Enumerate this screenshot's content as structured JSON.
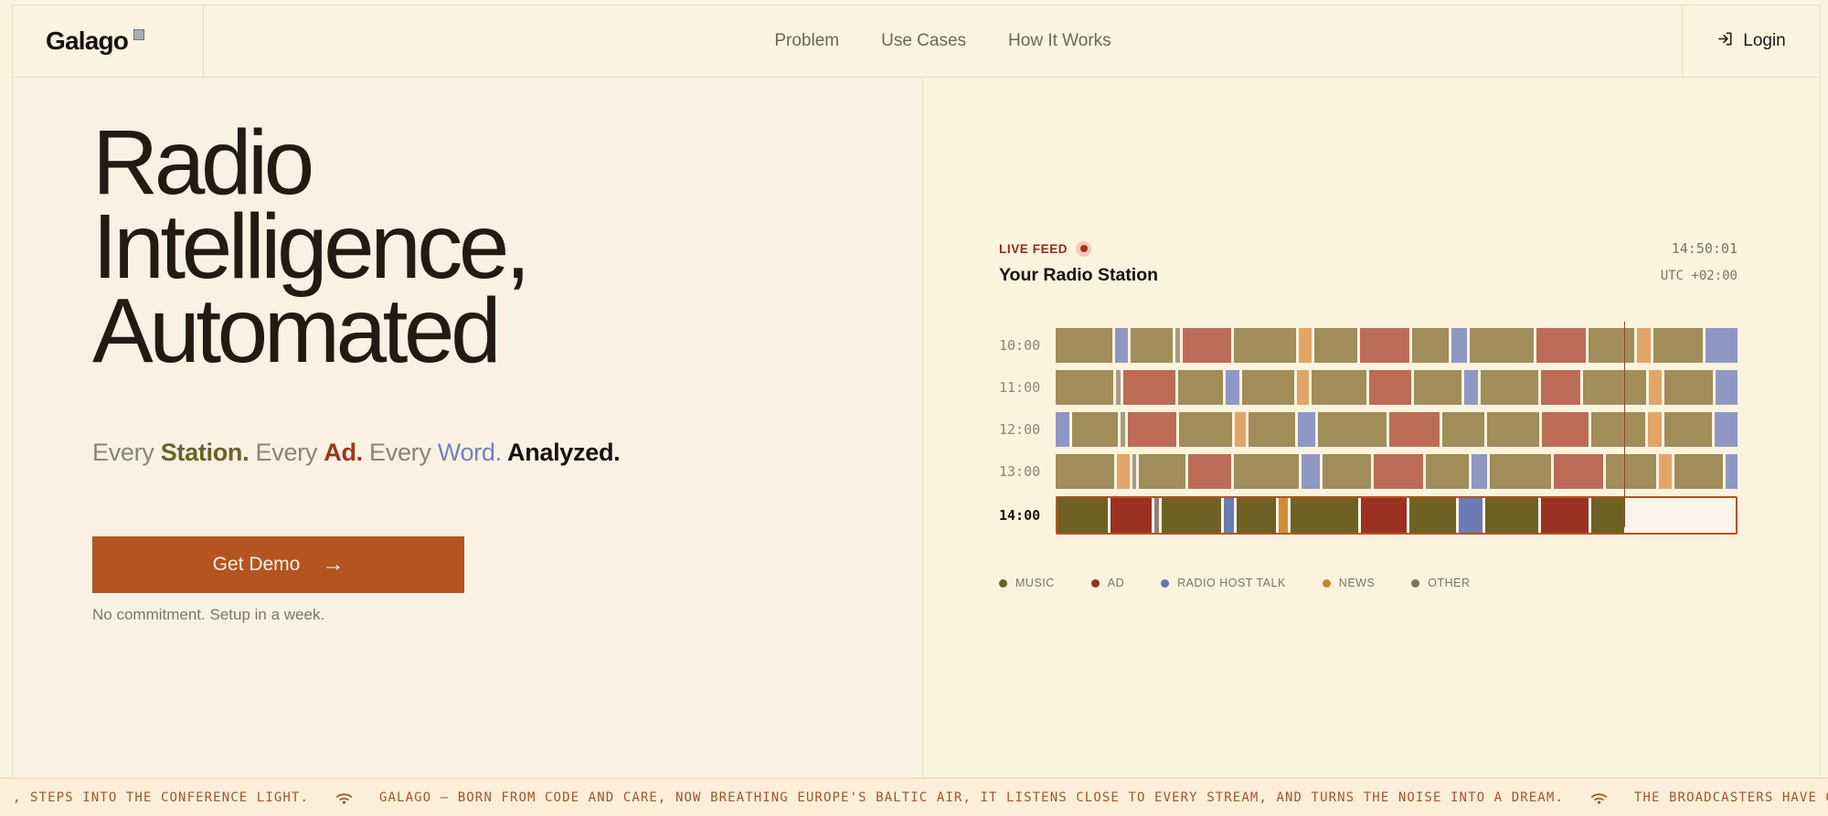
{
  "brand": {
    "name": "Galago"
  },
  "nav": {
    "items": [
      {
        "label": "Problem"
      },
      {
        "label": "Use Cases"
      },
      {
        "label": "How It Works"
      }
    ],
    "login_label": "Login"
  },
  "hero": {
    "title_lines": [
      "Radio",
      "Intelligence,",
      "Automated"
    ],
    "tagline": [
      {
        "text": "Every ",
        "style": "muted"
      },
      {
        "text": "Station.",
        "style": "station"
      },
      {
        "text": " Every ",
        "style": "muted"
      },
      {
        "text": "Ad.",
        "style": "ad"
      },
      {
        "text": " Every ",
        "style": "muted"
      },
      {
        "text": "Word.",
        "style": "word"
      },
      {
        "text": " Analyzed.",
        "style": "analyzed"
      }
    ],
    "cta_label": "Get Demo",
    "cta_arrow": "→",
    "cta_note": "No commitment. Setup in a week."
  },
  "live_feed": {
    "label": "LIVE FEED",
    "clock": "14:50:01",
    "station_title": "Your Radio Station",
    "timezone": "UTC +02:00"
  },
  "chart_data": {
    "type": "timeline",
    "title": "Your Radio Station",
    "x_unit": "minutes of each hour (0-60)",
    "now_time": "14:50:01",
    "now_fraction": 0.8335,
    "categories": [
      "MUSIC",
      "AD",
      "RADIO HOST TALK",
      "NEWS",
      "OTHER"
    ],
    "palette": {
      "muted": {
        "music": "#A18D59",
        "ad": "#BC6C56",
        "host": "#8F98C3",
        "news": "#E2A568",
        "other": "#A99B84",
        "empty": "transparent"
      },
      "active": {
        "music": "#6E6124",
        "ad": "#9A3122",
        "host": "#6B7CB4",
        "news": "#CE8C35",
        "other": "#8D8272",
        "empty": "transparent"
      }
    },
    "legend": [
      {
        "label": "MUSIC",
        "color": "#6E6124"
      },
      {
        "label": "AD",
        "color": "#99301F"
      },
      {
        "label": "RADIO HOST TALK",
        "color": "#5F74B2"
      },
      {
        "label": "NEWS",
        "color": "#CC8329"
      },
      {
        "label": "OTHER",
        "color": "#7D7260"
      }
    ],
    "rows": [
      {
        "label": "10:00",
        "active": false,
        "segments": [
          [
            "music",
            105
          ],
          [
            "host",
            25
          ],
          [
            "music",
            78
          ],
          [
            "other",
            8
          ],
          [
            "ad",
            90
          ],
          [
            "music",
            115
          ],
          [
            "news",
            24
          ],
          [
            "music",
            80
          ],
          [
            "ad",
            92
          ],
          [
            "music",
            68
          ],
          [
            "host",
            30
          ],
          [
            "music",
            118
          ],
          [
            "ad",
            92
          ],
          [
            "music",
            85
          ],
          [
            "news",
            25
          ],
          [
            "music",
            92
          ],
          [
            "host",
            60
          ]
        ]
      },
      {
        "label": "11:00",
        "active": false,
        "segments": [
          [
            "music",
            110
          ],
          [
            "other",
            8
          ],
          [
            "ad",
            100
          ],
          [
            "music",
            85
          ],
          [
            "host",
            27
          ],
          [
            "music",
            100
          ],
          [
            "news",
            22
          ],
          [
            "music",
            105
          ],
          [
            "ad",
            80
          ],
          [
            "music",
            90
          ],
          [
            "host",
            27
          ],
          [
            "music",
            110
          ],
          [
            "ad",
            75
          ],
          [
            "music",
            120
          ],
          [
            "news",
            25
          ],
          [
            "music",
            92
          ],
          [
            "host",
            42
          ]
        ]
      },
      {
        "label": "12:00",
        "active": false,
        "segments": [
          [
            "host",
            27
          ],
          [
            "music",
            88
          ],
          [
            "other",
            8
          ],
          [
            "ad",
            95
          ],
          [
            "music",
            102
          ],
          [
            "news",
            21
          ],
          [
            "music",
            90
          ],
          [
            "host",
            34
          ],
          [
            "music",
            133
          ],
          [
            "ad",
            97
          ],
          [
            "music",
            82
          ],
          [
            "music",
            100
          ],
          [
            "ad",
            90
          ],
          [
            "music",
            105
          ],
          [
            "news",
            26
          ],
          [
            "music",
            92
          ],
          [
            "host",
            45
          ]
        ]
      },
      {
        "label": "13:00",
        "active": false,
        "segments": [
          [
            "music",
            112
          ],
          [
            "news",
            24
          ],
          [
            "other",
            8
          ],
          [
            "music",
            88
          ],
          [
            "ad",
            82
          ],
          [
            "music",
            125
          ],
          [
            "host",
            35
          ],
          [
            "music",
            92
          ],
          [
            "ad",
            95
          ],
          [
            "music",
            82
          ],
          [
            "host",
            29
          ],
          [
            "music",
            117
          ],
          [
            "ad",
            95
          ],
          [
            "music",
            95
          ],
          [
            "news",
            24
          ],
          [
            "music",
            93
          ],
          [
            "host",
            23
          ]
        ]
      },
      {
        "label": "14:00",
        "active": true,
        "segments": [
          [
            "music",
            98
          ],
          [
            "ad",
            80
          ],
          [
            "other",
            8
          ],
          [
            "music",
            115
          ],
          [
            "host",
            20
          ],
          [
            "music",
            76
          ],
          [
            "news",
            17
          ],
          [
            "music",
            132
          ],
          [
            "ad",
            88
          ],
          [
            "music",
            90
          ],
          [
            "host",
            46
          ],
          [
            "music",
            104
          ],
          [
            "ad",
            91
          ],
          [
            "music",
            64
          ],
          [
            "empty",
            211
          ]
        ]
      }
    ]
  },
  "ticker": {
    "items": [
      ", STEPS INTO THE CONFERENCE LIGHT.",
      "GALAGO — BORN FROM CODE AND CARE, NOW BREATHING EUROPE'S BALTIC AIR, IT LISTENS CLOSE TO EVERY STREAM, AND TURNS THE NOISE INTO A DREAM.",
      "THE BROADCASTERS HAVE GATHERED IN RIGA"
    ]
  }
}
